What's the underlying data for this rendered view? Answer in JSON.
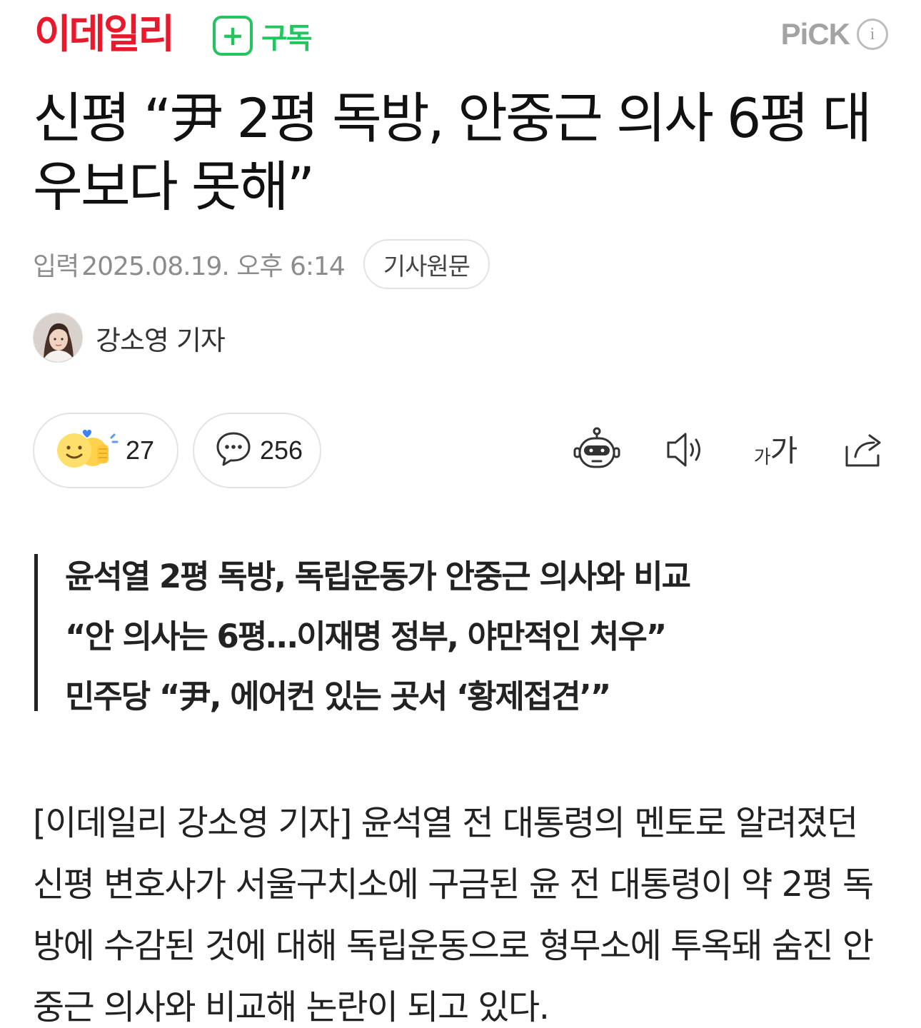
{
  "header": {
    "logo": "이데일리",
    "subscribe_plus": "+",
    "subscribe_label": "구독",
    "pick_label": "PiCK",
    "info_label": "i"
  },
  "article": {
    "title": "신평 “尹 2평 독방, 안중근 의사 6평 대우보다 못해”",
    "published_label": "입력",
    "published_at": "2025.08.19. 오후 6:14",
    "original_button": "기사원문",
    "author_name": "강소영 기자"
  },
  "actions": {
    "reaction_count": "27",
    "comment_count": "256",
    "font_size_small": "가",
    "font_size_large": "가"
  },
  "summary": [
    "윤석열 2평 독방, 독립운동가 안중근 의사와 비교",
    "“안 의사는 6평…이재명 정부, 야만적인 처우”",
    "민주당 “尹, 에어컨 있는 곳서 ‘황제접견’”"
  ],
  "body": {
    "paragraph": "[이데일리 강소영 기자] 윤석열 전 대통령의 멘토로 알려졌던 신평 변호사가 서울구치소에 구금된 윤 전 대통령이 약 2평 독방에 수감된 것에 대해 독립운동으로 형무소에 투옥돼 숨진 안중근 의사와 비교해 논란이 되고 있다."
  },
  "colors": {
    "brand_red": "#e8192c",
    "subscribe_green": "#22c55e",
    "muted_gray": "#8c8c8c"
  },
  "icons": [
    "plus-icon",
    "info-icon",
    "emoji-reaction-icon",
    "comment-bubble-icon",
    "ai-robot-icon",
    "speaker-icon",
    "font-size-icon",
    "share-icon"
  ]
}
